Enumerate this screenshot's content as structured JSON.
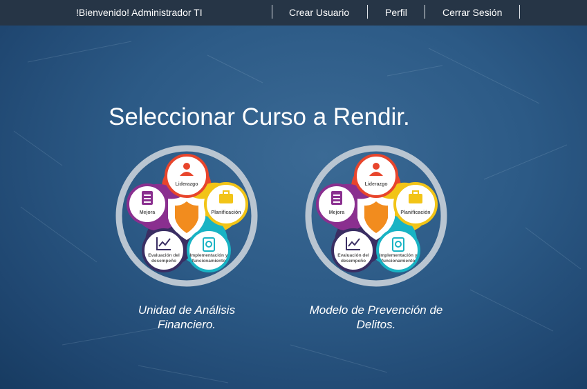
{
  "navbar": {
    "welcome": "!Bienvenido! Administrador TI",
    "links": [
      {
        "label": "Crear Usuario"
      },
      {
        "label": "Perfil"
      },
      {
        "label": "Cerrar Sesión"
      }
    ]
  },
  "page": {
    "title": "Seleccionar Curso a Rendir."
  },
  "wheel": {
    "labels": {
      "liderazgo": "Liderazgo",
      "planificacion": "Planificación",
      "mejora": "Mejora",
      "evaluacion_1": "Evaluación del",
      "evaluacion_2": "desempeño",
      "implementacion_1": "Implementación y",
      "implementacion_2": "funcionamiento"
    },
    "colors": {
      "liderazgo": "#e8452c",
      "planificacion": "#f2c417",
      "implementacion": "#19b3c4",
      "evaluacion": "#3a2e63",
      "mejora": "#8a2f8f",
      "center": "#f28c1e"
    }
  },
  "courses": [
    {
      "name_line1": "Unidad de Análisis",
      "name_line2": "Financiero."
    },
    {
      "name_line1": "Modelo de Prevención de",
      "name_line2": "Delitos."
    }
  ]
}
